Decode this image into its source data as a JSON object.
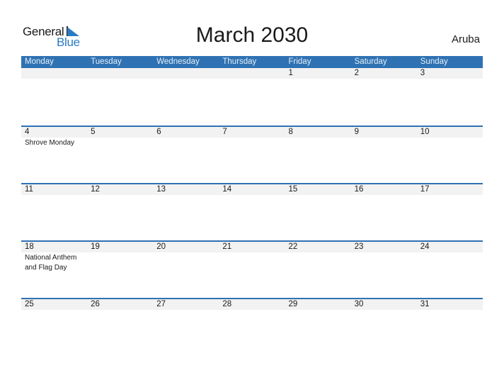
{
  "logo": {
    "general": "General",
    "blue": "Blue"
  },
  "title": "March 2030",
  "country": "Aruba",
  "colors": {
    "header_bg": "#2e72b3",
    "accent": "#2a7bc4",
    "day_row_bg": "#f2f2f2"
  },
  "weekdays": [
    "Monday",
    "Tuesday",
    "Wednesday",
    "Thursday",
    "Friday",
    "Saturday",
    "Sunday"
  ],
  "weeks": [
    {
      "days": [
        "",
        "",
        "",
        "",
        "1",
        "2",
        "3"
      ],
      "events": [
        "",
        "",
        "",
        "",
        "",
        "",
        ""
      ]
    },
    {
      "days": [
        "4",
        "5",
        "6",
        "7",
        "8",
        "9",
        "10"
      ],
      "events": [
        "Shrove Monday",
        "",
        "",
        "",
        "",
        "",
        ""
      ]
    },
    {
      "days": [
        "11",
        "12",
        "13",
        "14",
        "15",
        "16",
        "17"
      ],
      "events": [
        "",
        "",
        "",
        "",
        "",
        "",
        ""
      ]
    },
    {
      "days": [
        "18",
        "19",
        "20",
        "21",
        "22",
        "23",
        "24"
      ],
      "events": [
        "National Anthem and Flag Day",
        "",
        "",
        "",
        "",
        "",
        ""
      ]
    },
    {
      "days": [
        "25",
        "26",
        "27",
        "28",
        "29",
        "30",
        "31"
      ],
      "events": [
        "",
        "",
        "",
        "",
        "",
        "",
        ""
      ]
    }
  ]
}
